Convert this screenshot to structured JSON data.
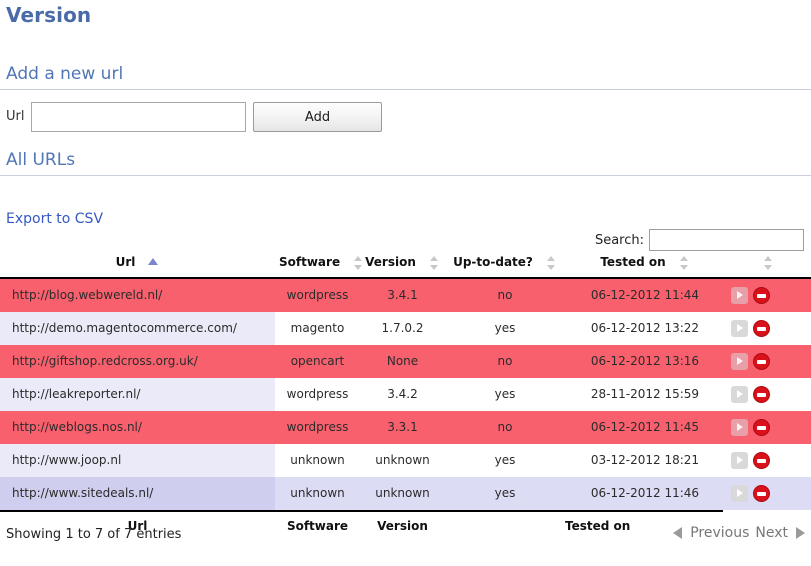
{
  "page": {
    "title": "Version"
  },
  "add_section": {
    "heading": "Add a new url",
    "url_label": "Url",
    "url_value": "",
    "url_placeholder": "",
    "add_button": "Add"
  },
  "list_section": {
    "heading": "All URLs",
    "export_link": "Export to CSV",
    "search_label": "Search:",
    "search_value": "",
    "search_placeholder": ""
  },
  "table": {
    "columns": [
      {
        "label": "Url",
        "sort": "asc"
      },
      {
        "label": "Software",
        "sort": "none"
      },
      {
        "label": "Version",
        "sort": "none"
      },
      {
        "label": "Up-to-date?",
        "sort": "none"
      },
      {
        "label": "Tested on",
        "sort": "none"
      },
      {
        "label": "",
        "sort": "none"
      }
    ],
    "footer_columns": [
      "Url",
      "Software",
      "Version",
      "Tested on"
    ],
    "rows": [
      {
        "url": "http://blog.webwereld.nl/",
        "software": "wordpress",
        "version": "3.4.1",
        "uptodate": "no",
        "tested_on": "06-12-2012 11:44",
        "state": "bad"
      },
      {
        "url": "http://demo.magentocommerce.com/",
        "software": "magento",
        "version": "1.7.0.2",
        "uptodate": "yes",
        "tested_on": "06-12-2012 13:22",
        "state": "ok"
      },
      {
        "url": "http://giftshop.redcross.org.uk/",
        "software": "opencart",
        "version": "None",
        "uptodate": "no",
        "tested_on": "06-12-2012 13:16",
        "state": "bad"
      },
      {
        "url": "http://leakreporter.nl/",
        "software": "wordpress",
        "version": "3.4.2",
        "uptodate": "yes",
        "tested_on": "28-11-2012 15:59",
        "state": "ok"
      },
      {
        "url": "http://weblogs.nos.nl/",
        "software": "wordpress",
        "version": "3.3.1",
        "uptodate": "no",
        "tested_on": "06-12-2012 11:45",
        "state": "bad"
      },
      {
        "url": "http://www.joop.nl",
        "software": "unknown",
        "version": "unknown",
        "uptodate": "yes",
        "tested_on": "03-12-2012 18:21",
        "state": "ok"
      },
      {
        "url": "http://www.sitedeals.nl/",
        "software": "unknown",
        "version": "unknown",
        "uptodate": "yes",
        "tested_on": "06-12-2012 11:46",
        "state": "highlight"
      }
    ],
    "row_actions": {
      "play": "run-test",
      "delete": "delete-url"
    }
  },
  "footer": {
    "info": "Showing 1 to 7 of 7 entries",
    "previous": "Previous",
    "next": "Next"
  },
  "colors": {
    "heading": "#5176b5",
    "link": "#3558c6",
    "row_bad": "#f9606e",
    "row_highlight": "#dddcf5",
    "sort_active": "#7b85cf",
    "delete": "#d8111b"
  }
}
